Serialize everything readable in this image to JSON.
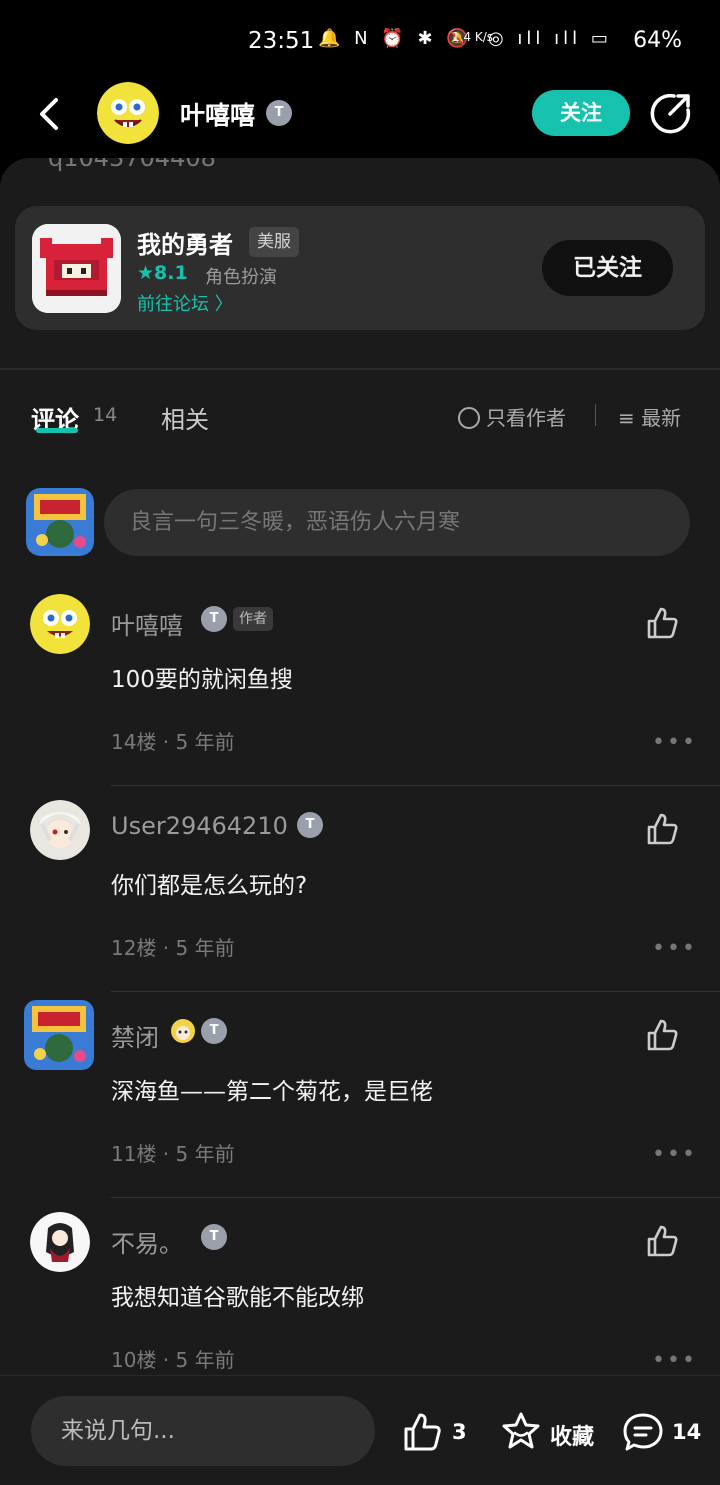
{
  "status_bar": {
    "time": "23:51",
    "net_speed": "1.4 K/s",
    "battery": "64%"
  },
  "header": {
    "username": "叶嘻嘻",
    "level_badge": "T",
    "follow_label": "关注"
  },
  "post_cut_text": "q1043704408",
  "game_card": {
    "name": "我的勇者",
    "tag": "美服",
    "score": "8.1",
    "genre": "角色扮演",
    "forum_link": "前往论坛",
    "followed_label": "已关注"
  },
  "tabs": {
    "comments_label": "评论",
    "comments_count": "14",
    "related_label": "相关",
    "only_author": "只看作者",
    "sort": "最新"
  },
  "compose": {
    "placeholder": "良言一句三冬暖，恶语伤人六月寒"
  },
  "comments": [
    {
      "name": "叶嘻嘻",
      "author_tag": "作者",
      "text": "100要的就闲鱼搜",
      "floor": "14楼",
      "time": "5 年前"
    },
    {
      "name": "User29464210",
      "text": "你们都是怎么玩的?",
      "floor": "12楼",
      "time": "5 年前"
    },
    {
      "name": "禁闭",
      "text": "深海鱼——第二个菊花，是巨佬",
      "floor": "11楼",
      "time": "5 年前"
    },
    {
      "name": "不易。",
      "text": "我想知道谷歌能不能改绑",
      "floor": "10楼",
      "time": "5 年前"
    }
  ],
  "bottom_bar": {
    "input_placeholder": "来说几句...",
    "like_count": "3",
    "favorite_label": "收藏",
    "comment_count": "14"
  },
  "colors": {
    "accent": "#16c2ad",
    "background": "#1b1b1b",
    "card": "#2e2e2e"
  },
  "icons": [
    "back-icon",
    "share-icon",
    "star-icon",
    "chevron-right-icon",
    "sort-icon",
    "like-icon",
    "more-icon",
    "favorite-icon",
    "comment-icon"
  ]
}
